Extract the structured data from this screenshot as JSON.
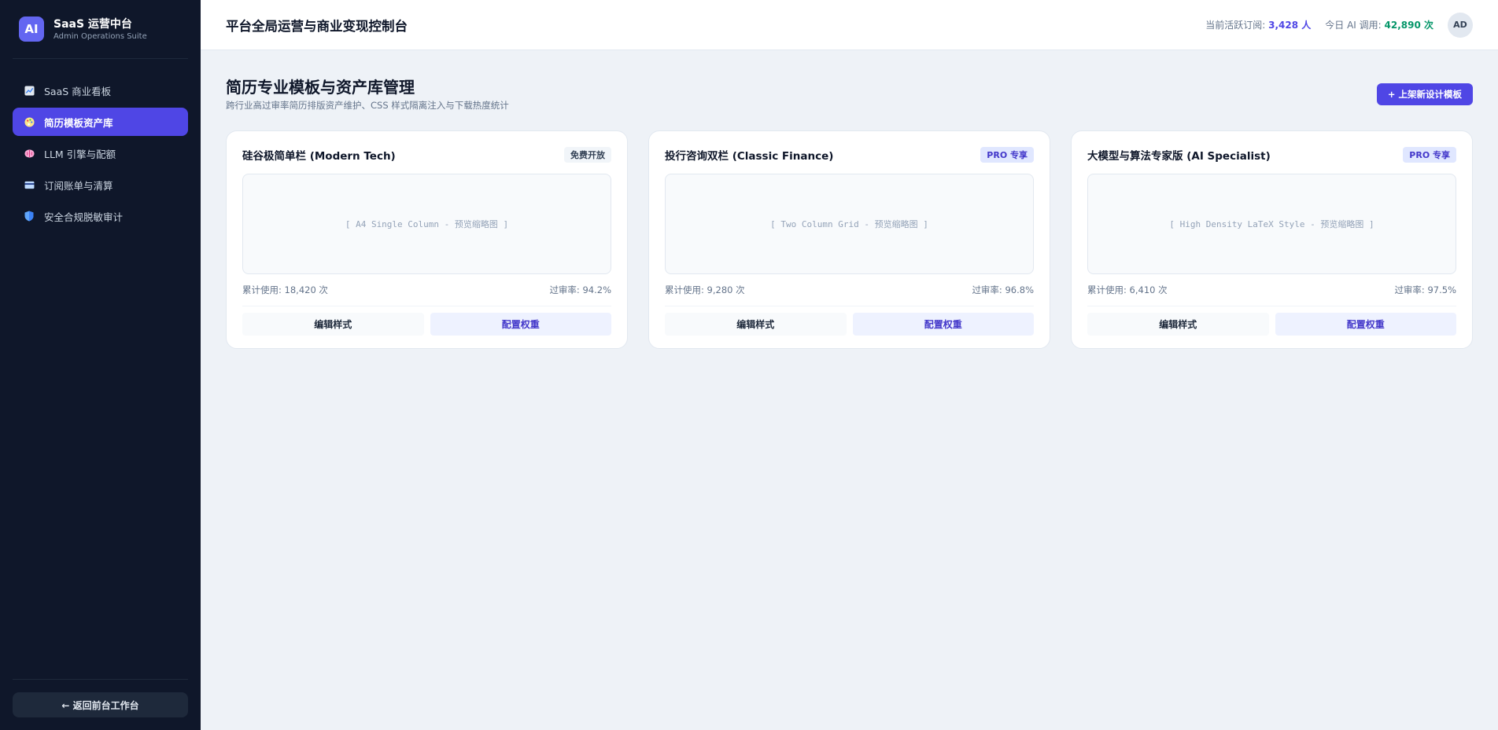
{
  "brand": {
    "logo": "AI",
    "title": "SaaS 运营中台",
    "subtitle": "Admin Operations Suite"
  },
  "sidebar": {
    "items": [
      {
        "label": "SaaS 商业看板",
        "icon": "chart-icon",
        "active": false
      },
      {
        "label": "简历模板资产库",
        "icon": "palette-icon",
        "active": true
      },
      {
        "label": "LLM 引擎与配额",
        "icon": "brain-icon",
        "active": false
      },
      {
        "label": "订阅账单与清算",
        "icon": "card-icon",
        "active": false
      },
      {
        "label": "安全合规脱敏审计",
        "icon": "shield-icon",
        "active": false
      }
    ],
    "back_label": "← 返回前台工作台"
  },
  "topbar": {
    "title": "平台全局运营与商业变现控制台",
    "subs_label": "当前活跃订阅:",
    "subs_value": "3,428 人",
    "ai_label": "今日 AI 调用:",
    "ai_value": "42,890 次",
    "avatar": "AD"
  },
  "section": {
    "title": "简历专业模板与资产库管理",
    "subtitle": "跨行业高过审率简历排版资产维护、CSS 样式隔离注入与下载热度统计",
    "add_button": "+ 上架新设计模板"
  },
  "cards": [
    {
      "title": "硅谷极简单栏 (Modern Tech)",
      "badge": "免费开放",
      "badge_type": "free",
      "preview": "[ A4 Single Column - 预览缩略图 ]",
      "usage": "累计使用: 18,420 次",
      "pass_rate": "过审率: 94.2%",
      "edit": "编辑样式",
      "weight": "配置权重"
    },
    {
      "title": "投行咨询双栏 (Classic Finance)",
      "badge": "PRO 专享",
      "badge_type": "pro",
      "preview": "[ Two Column Grid - 预览缩略图 ]",
      "usage": "累计使用: 9,280 次",
      "pass_rate": "过审率: 96.8%",
      "edit": "编辑样式",
      "weight": "配置权重"
    },
    {
      "title": "大模型与算法专家版 (AI Specialist)",
      "badge": "PRO 专享",
      "badge_type": "pro",
      "preview": "[ High Density LaTeX Style - 预览缩略图 ]",
      "usage": "累计使用: 6,410 次",
      "pass_rate": "过审率: 97.5%",
      "edit": "编辑样式",
      "weight": "配置权重"
    }
  ],
  "colors": {
    "sidebar_bg": "#0f172a",
    "accent": "#4f46e5",
    "page_bg": "#eef2f7",
    "success": "#059669"
  }
}
